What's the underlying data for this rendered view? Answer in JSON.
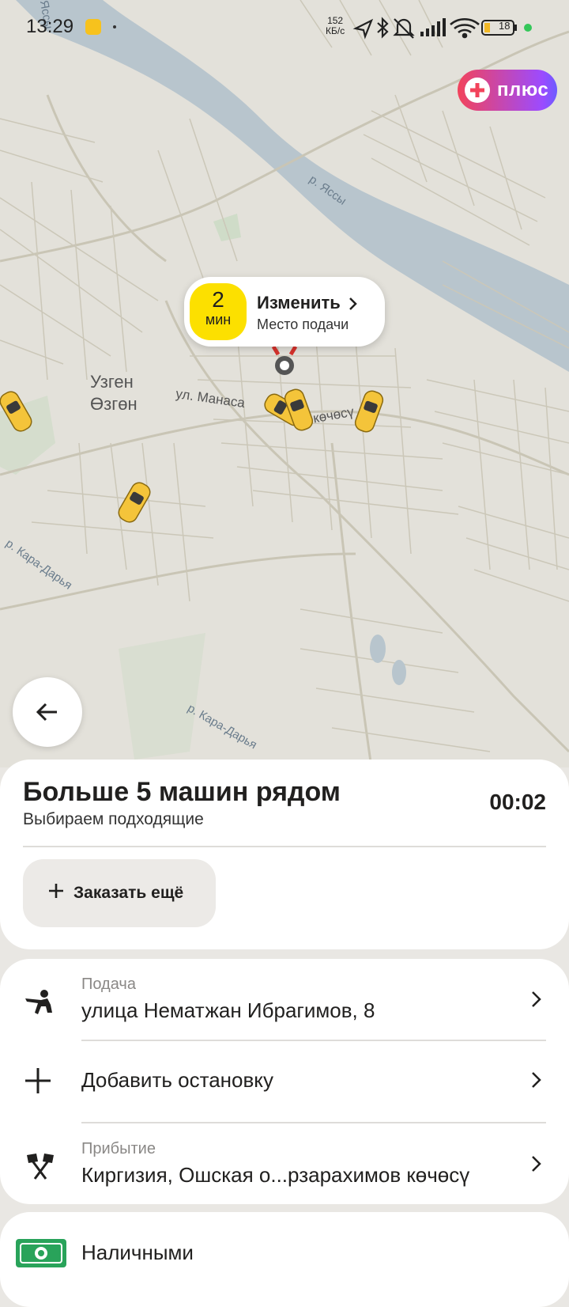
{
  "status_bar": {
    "time": "13:29",
    "speed_value": "152",
    "speed_unit": "КБ/с",
    "battery": "18"
  },
  "plus_badge": {
    "label": "плюс"
  },
  "map": {
    "city_label_line1": "Узген",
    "city_label_line2": "Өзгөн",
    "street_label": "ул. Манаса",
    "street_label_2": "көчөсү",
    "river_1": "р. Яссы",
    "river_2": "р. Кара-Дарья",
    "river_3": "р. Кара-Дарья",
    "corner_label": "Яссы"
  },
  "pickup_bubble": {
    "eta_value": "2",
    "eta_unit": "мин",
    "action": "Изменить",
    "caption": "Место подачи"
  },
  "search_status": {
    "title": "Больше 5 машин рядом",
    "subtitle": "Выбираем подходящие",
    "timer": "00:02",
    "order_more_label": "Заказать ещё"
  },
  "route": {
    "pickup_caption": "Подача",
    "pickup_address": "улица Нематжан Ибрагимов, 8",
    "add_stop_label": "Добавить остановку",
    "arrival_caption": "Прибытие",
    "arrival_address": "Киргизия, Ошская о...рзарахимов көчөсү"
  },
  "payment": {
    "method": "Наличными"
  },
  "colors": {
    "accent_yellow": "#fce000",
    "plus_gradient_start": "#f2435b",
    "plus_gradient_end": "#6d5cff",
    "river": "#b9c6cf"
  }
}
